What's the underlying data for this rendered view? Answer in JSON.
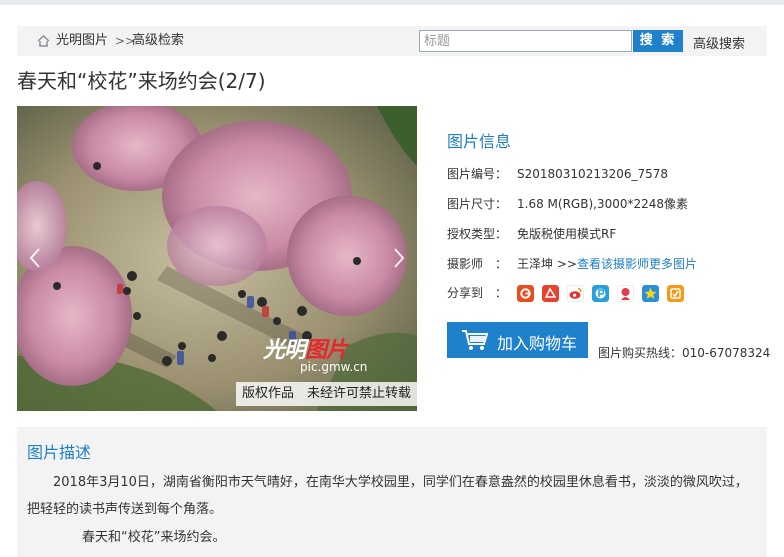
{
  "nav": {
    "home": "光明图片",
    "separator": ">>",
    "advanced": "高级检索",
    "search_placeholder": "标题",
    "search_button": "搜 索",
    "advanced_search": "高级搜索"
  },
  "title": "春天和“校花”来场约会(2/7)",
  "photo": {
    "watermark_logo_white": "光明",
    "watermark_logo_red": "图片",
    "watermark_site": "pic.gmw.cn",
    "copyright": "版权作品　未经许可禁止转载"
  },
  "info": {
    "heading": "图片信息",
    "rows": [
      {
        "label": "图片编号：",
        "value": "S20180310213206_7578"
      },
      {
        "label": "图片尺寸：",
        "value": "1.68 M(RGB),3000*2248像素"
      },
      {
        "label": "授权类型：",
        "value": "免版税使用模式RF"
      },
      {
        "label": "摄影师　：",
        "value": "王泽坤 >>",
        "link": "查看该摄影师更多图片"
      },
      {
        "label": "分享到　："
      }
    ],
    "share_icons": [
      {
        "name": "google-share-icon",
        "color": "#e94c1e"
      },
      {
        "name": "social-share-icon",
        "color": "#e8412e"
      },
      {
        "name": "weibo-share-icon",
        "color": "#ffffff"
      },
      {
        "name": "p-share-icon",
        "color": "#29a0dc"
      },
      {
        "name": "renren-share-icon",
        "color": "#e23c4c"
      },
      {
        "name": "star-share-icon",
        "color": "#2a8ed8"
      },
      {
        "name": "qzone-share-icon",
        "color": "#f39a1b"
      }
    ]
  },
  "cart": {
    "label": "加入购物车"
  },
  "hotline": "图片购买热线：010-67078324",
  "description": {
    "heading": "图片描述",
    "text": "2018年3月10日，湖南省衡阳市天气晴好，在南华大学校园里，同学们在春意盎然的校园里休息看书，淡淡的微风吹过，把轻轻的读书声传送到每个角落。",
    "sub": "春天和“校花”来场约会。"
  }
}
